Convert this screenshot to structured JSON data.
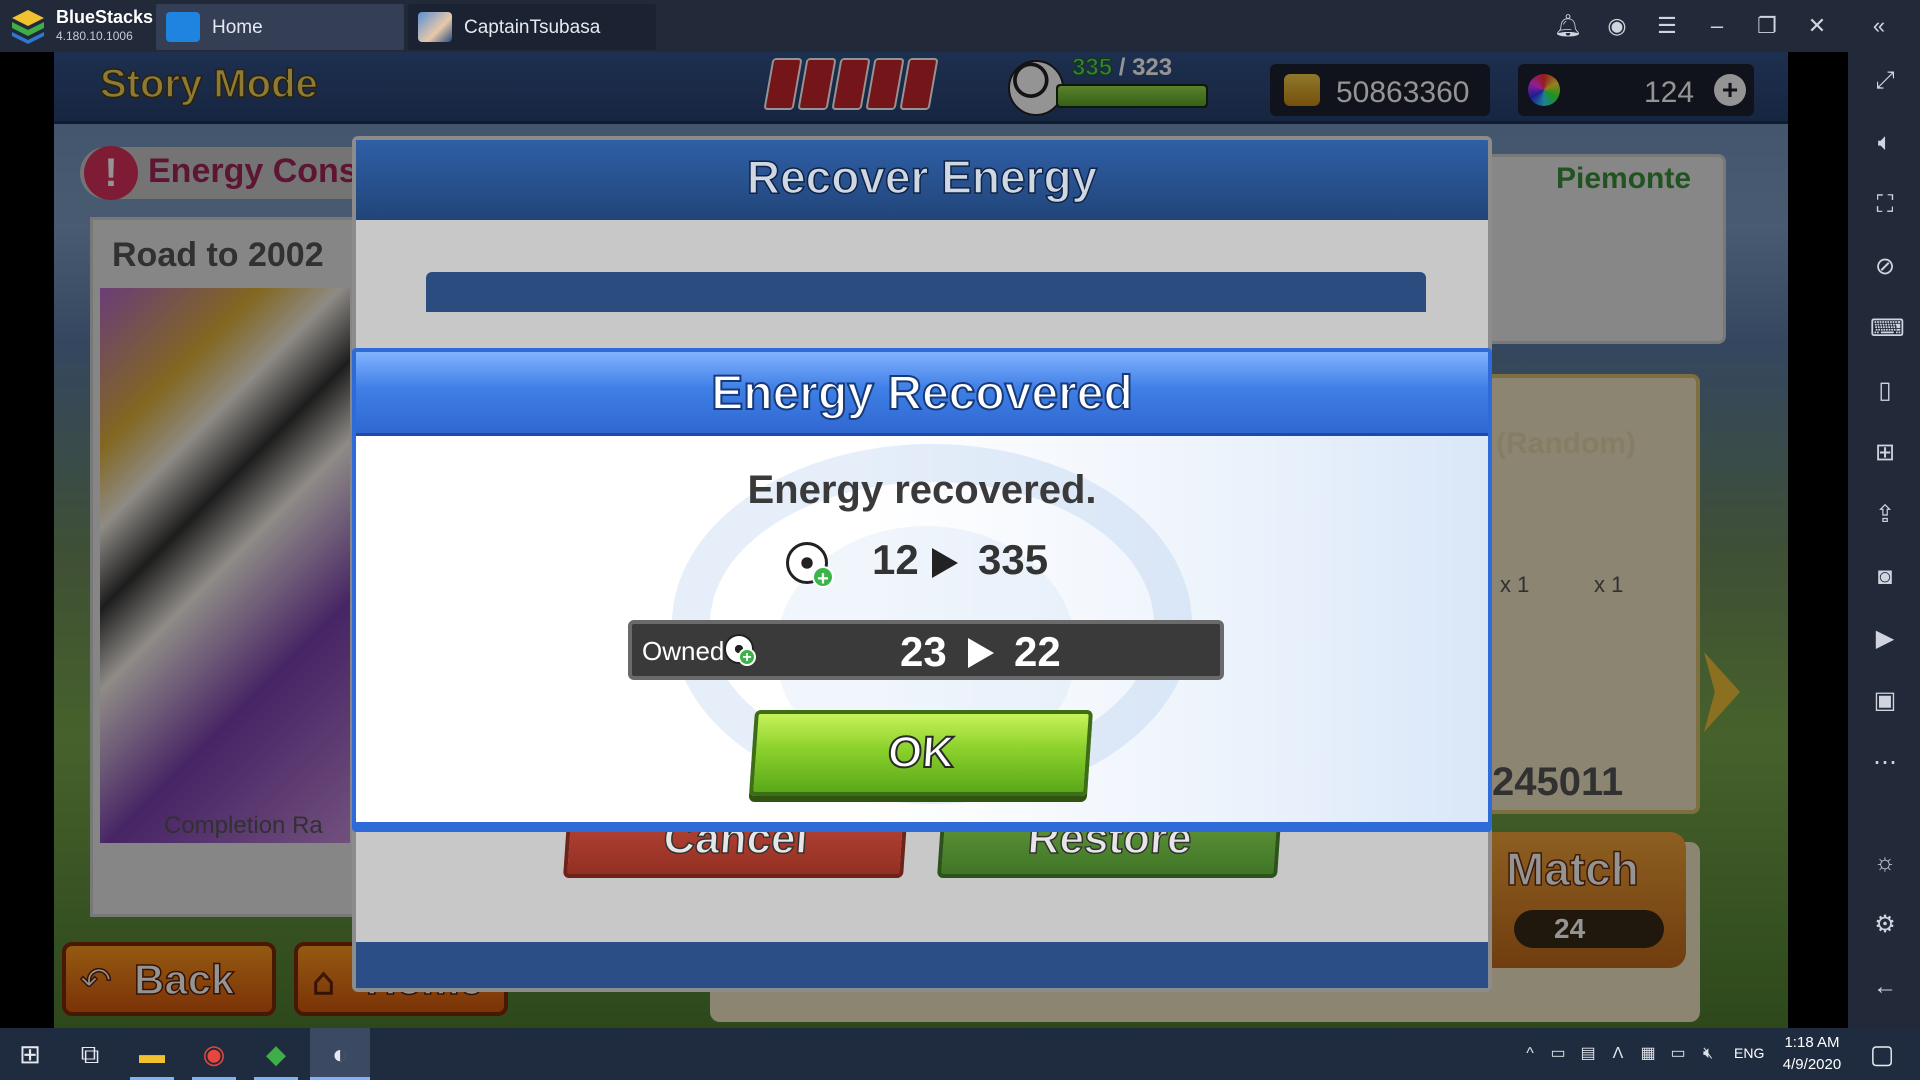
{
  "window": {
    "app_name": "BlueStacks",
    "version": "4.180.10.1006",
    "tabs": [
      {
        "label": "Home"
      },
      {
        "label": "CaptainTsubasa"
      }
    ]
  },
  "game": {
    "mode_title": "Story Mode",
    "stamina": {
      "current": "335",
      "separator": "/",
      "max": "323"
    },
    "coins": "50863360",
    "dreamballs": "124",
    "background": {
      "energy_banner": "Energy Consu",
      "chapter_title": "Road to 2002",
      "completion_label": "Completion Ra",
      "team_name": "Piemonte",
      "reward_label": "(Random)",
      "reward_count_1": "x 1",
      "reward_count_2": "x 1",
      "match_id": "245011",
      "match_button": "Match",
      "match_cost": "24",
      "back_button": "Back",
      "home_button": "Home"
    },
    "recover_dialog": {
      "title": "Recover Energy",
      "cancel_label": "Cancel",
      "restore_label": "Restore"
    },
    "recovered_modal": {
      "title": "Energy Recovered",
      "message": "Energy recovered.",
      "energy_from": "12",
      "energy_to": "335",
      "owned_label": "Owned",
      "owned_from": "23",
      "owned_to": "22",
      "ok_label": "OK"
    }
  },
  "taskbar": {
    "language": "ENG",
    "time": "1:18 AM",
    "date": "4/9/2020"
  },
  "icons": {
    "titlebar": [
      "bell-icon",
      "account-icon",
      "menu-icon",
      "minimize-icon",
      "restore-icon",
      "close-icon",
      "collapse-sidebar-icon"
    ],
    "sidebar": [
      "fullscreen-icon",
      "volume-icon",
      "screenshot-region-icon",
      "eye-off-icon",
      "keyboard-icon",
      "phone-rotate-icon",
      "gamepad-icon",
      "install-apk-icon",
      "camera-icon",
      "record-icon",
      "media-folder-icon",
      "more-icon",
      "light-icon",
      "settings-icon",
      "back-icon"
    ]
  }
}
